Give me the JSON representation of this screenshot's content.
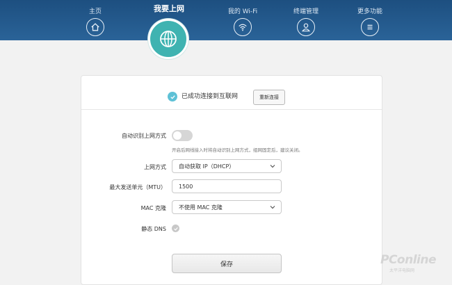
{
  "nav": {
    "home": {
      "label": "主页",
      "icon": "home-icon"
    },
    "internet": {
      "label": "我要上网",
      "icon": "globe-icon",
      "active": true
    },
    "wifi": {
      "label": "我的 Wi-Fi",
      "icon": "wifi-icon"
    },
    "devices": {
      "label": "终端管理",
      "icon": "user-icon"
    },
    "more": {
      "label": "更多功能",
      "icon": "menu-icon"
    }
  },
  "status": {
    "text": "已成功连接到互联网",
    "reconnect_label": "重新连接"
  },
  "form": {
    "auto_detect_label": "自动识别上网方式",
    "auto_detect_on": false,
    "hint": "开启后网线接入时将自动识别上网方式，组网固定后，建议关闭。",
    "mode_label": "上网方式",
    "mode_value": "自动获取 IP（DHCP）",
    "mtu_label": "最大发送单元（MTU）",
    "mtu_value": "1500",
    "mac_label": "MAC 克隆",
    "mac_value": "不使用 MAC 克隆",
    "dns_label": "静态 DNS",
    "dns_checked": false,
    "save_label": "保存"
  },
  "watermark": {
    "brand": "PConline",
    "sub": "太平洋电脑网"
  },
  "colors": {
    "topbar": "#1d4f80",
    "accent": "#3fb3b1",
    "check": "#5ec1d6"
  }
}
